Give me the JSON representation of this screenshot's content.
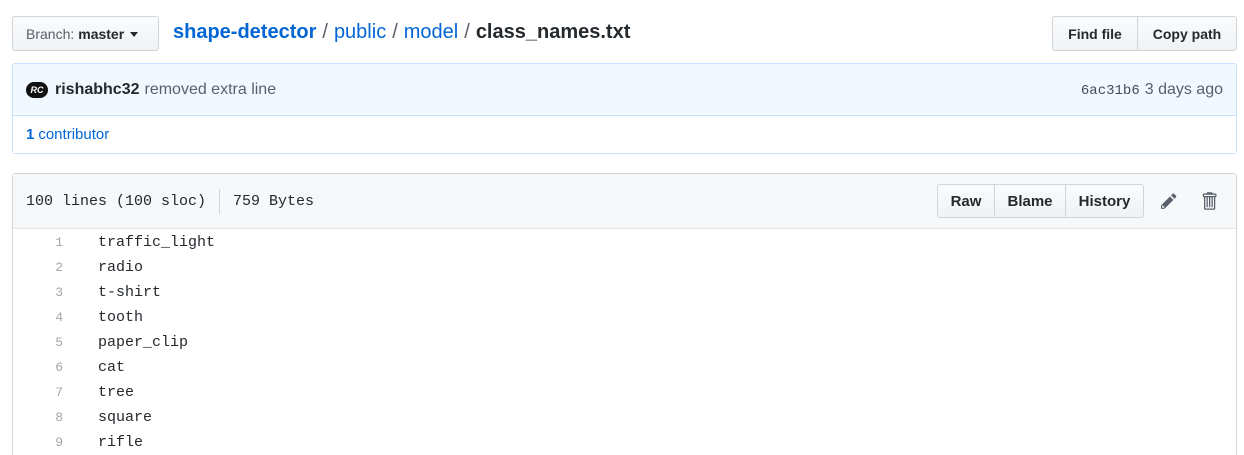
{
  "branch": {
    "label": "Branch:",
    "name": "master"
  },
  "breadcrumb": {
    "repo": "shape-detector",
    "dir1": "public",
    "dir2": "model",
    "file": "class_names.txt",
    "sep": "/"
  },
  "nav_buttons": {
    "find_file": "Find file",
    "copy_path": "Copy path"
  },
  "commit": {
    "avatar_text": "RC",
    "author": "rishabhc32",
    "message": "removed extra line",
    "sha": "6ac31b6",
    "ago": "3 days ago",
    "contributors_count": "1",
    "contributors_label": "contributor"
  },
  "file": {
    "lines_info": "100 lines (100 sloc)",
    "size": "759 Bytes",
    "actions": {
      "raw": "Raw",
      "blame": "Blame",
      "history": "History"
    },
    "icons": {
      "edit": "pencil-icon",
      "delete": "trash-icon"
    },
    "lines": [
      {
        "n": "1",
        "text": "traffic_light"
      },
      {
        "n": "2",
        "text": "radio"
      },
      {
        "n": "3",
        "text": "t-shirt"
      },
      {
        "n": "4",
        "text": "tooth"
      },
      {
        "n": "5",
        "text": "paper_clip"
      },
      {
        "n": "6",
        "text": "cat"
      },
      {
        "n": "7",
        "text": "tree"
      },
      {
        "n": "8",
        "text": "square"
      },
      {
        "n": "9",
        "text": "rifle"
      }
    ]
  },
  "colors": {
    "link": "#0366d6",
    "commit_bg": "#f1f8ff",
    "header_bg": "#f6f8fa"
  }
}
